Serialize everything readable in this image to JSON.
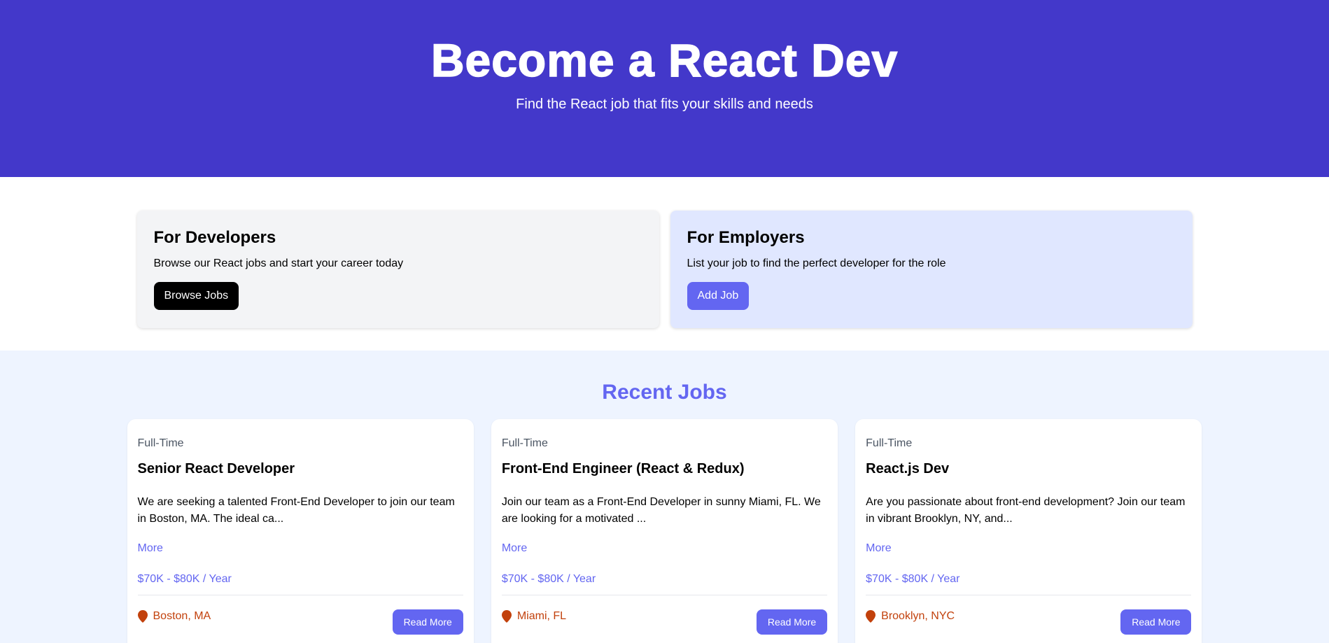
{
  "hero": {
    "title": "Become a React Dev",
    "subtitle": "Find the React job that fits your skills and needs"
  },
  "cards": {
    "developers": {
      "title": "For Developers",
      "text": "Browse our React jobs and start your career today",
      "button": "Browse Jobs"
    },
    "employers": {
      "title": "For Employers",
      "text": "List your job to find the perfect developer for the role",
      "button": "Add Job"
    }
  },
  "jobs": {
    "heading": "Recent Jobs",
    "items": [
      {
        "type": "Full-Time",
        "title": "Senior React Developer",
        "description": "We are seeking a talented Front-End Developer to join our team in Boston, MA. The ideal ca...",
        "more": "More",
        "salary": "$70K - $80K / Year",
        "location": "Boston, MA",
        "button": "Read More"
      },
      {
        "type": "Full-Time",
        "title": "Front-End Engineer (React & Redux)",
        "description": "Join our team as a Front-End Developer in sunny Miami, FL. We are looking for a motivated ...",
        "more": "More",
        "salary": "$70K - $80K / Year",
        "location": "Miami, FL",
        "button": "Read More"
      },
      {
        "type": "Full-Time",
        "title": "React.js Dev",
        "description": "Are you passionate about front-end development? Join our team in vibrant Brooklyn, NY, and...",
        "more": "More",
        "salary": "$70K - $80K / Year",
        "location": "Brooklyn, NYC",
        "button": "Read More"
      }
    ]
  },
  "colors": {
    "hero_bg": "#4338ca",
    "accent": "#6366f1",
    "location": "#c2410c",
    "jobs_bg": "#eef4ff",
    "employers_bg": "#e0e7ff"
  },
  "icons": {
    "location": "map-marker-icon"
  }
}
